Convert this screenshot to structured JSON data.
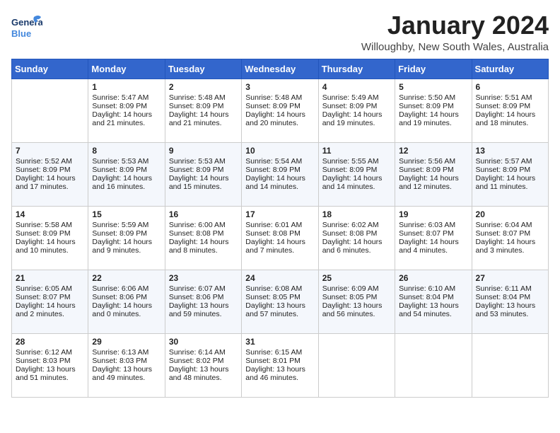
{
  "header": {
    "logo_text_general": "General",
    "logo_text_blue": "Blue",
    "month_title": "January 2024",
    "location": "Willoughby, New South Wales, Australia"
  },
  "weekdays": [
    "Sunday",
    "Monday",
    "Tuesday",
    "Wednesday",
    "Thursday",
    "Friday",
    "Saturday"
  ],
  "weeks": [
    [
      {
        "day": "",
        "empty": true
      },
      {
        "day": "1",
        "sunrise": "5:47 AM",
        "sunset": "8:09 PM",
        "daylight": "14 hours and 21 minutes."
      },
      {
        "day": "2",
        "sunrise": "5:48 AM",
        "sunset": "8:09 PM",
        "daylight": "14 hours and 21 minutes."
      },
      {
        "day": "3",
        "sunrise": "5:48 AM",
        "sunset": "8:09 PM",
        "daylight": "14 hours and 20 minutes."
      },
      {
        "day": "4",
        "sunrise": "5:49 AM",
        "sunset": "8:09 PM",
        "daylight": "14 hours and 19 minutes."
      },
      {
        "day": "5",
        "sunrise": "5:50 AM",
        "sunset": "8:09 PM",
        "daylight": "14 hours and 19 minutes."
      },
      {
        "day": "6",
        "sunrise": "5:51 AM",
        "sunset": "8:09 PM",
        "daylight": "14 hours and 18 minutes."
      }
    ],
    [
      {
        "day": "7",
        "sunrise": "5:52 AM",
        "sunset": "8:09 PM",
        "daylight": "14 hours and 17 minutes."
      },
      {
        "day": "8",
        "sunrise": "5:53 AM",
        "sunset": "8:09 PM",
        "daylight": "14 hours and 16 minutes."
      },
      {
        "day": "9",
        "sunrise": "5:53 AM",
        "sunset": "8:09 PM",
        "daylight": "14 hours and 15 minutes."
      },
      {
        "day": "10",
        "sunrise": "5:54 AM",
        "sunset": "8:09 PM",
        "daylight": "14 hours and 14 minutes."
      },
      {
        "day": "11",
        "sunrise": "5:55 AM",
        "sunset": "8:09 PM",
        "daylight": "14 hours and 14 minutes."
      },
      {
        "day": "12",
        "sunrise": "5:56 AM",
        "sunset": "8:09 PM",
        "daylight": "14 hours and 12 minutes."
      },
      {
        "day": "13",
        "sunrise": "5:57 AM",
        "sunset": "8:09 PM",
        "daylight": "14 hours and 11 minutes."
      }
    ],
    [
      {
        "day": "14",
        "sunrise": "5:58 AM",
        "sunset": "8:09 PM",
        "daylight": "14 hours and 10 minutes."
      },
      {
        "day": "15",
        "sunrise": "5:59 AM",
        "sunset": "8:09 PM",
        "daylight": "14 hours and 9 minutes."
      },
      {
        "day": "16",
        "sunrise": "6:00 AM",
        "sunset": "8:08 PM",
        "daylight": "14 hours and 8 minutes."
      },
      {
        "day": "17",
        "sunrise": "6:01 AM",
        "sunset": "8:08 PM",
        "daylight": "14 hours and 7 minutes."
      },
      {
        "day": "18",
        "sunrise": "6:02 AM",
        "sunset": "8:08 PM",
        "daylight": "14 hours and 6 minutes."
      },
      {
        "day": "19",
        "sunrise": "6:03 AM",
        "sunset": "8:07 PM",
        "daylight": "14 hours and 4 minutes."
      },
      {
        "day": "20",
        "sunrise": "6:04 AM",
        "sunset": "8:07 PM",
        "daylight": "14 hours and 3 minutes."
      }
    ],
    [
      {
        "day": "21",
        "sunrise": "6:05 AM",
        "sunset": "8:07 PM",
        "daylight": "14 hours and 2 minutes."
      },
      {
        "day": "22",
        "sunrise": "6:06 AM",
        "sunset": "8:06 PM",
        "daylight": "14 hours and 0 minutes."
      },
      {
        "day": "23",
        "sunrise": "6:07 AM",
        "sunset": "8:06 PM",
        "daylight": "13 hours and 59 minutes."
      },
      {
        "day": "24",
        "sunrise": "6:08 AM",
        "sunset": "8:05 PM",
        "daylight": "13 hours and 57 minutes."
      },
      {
        "day": "25",
        "sunrise": "6:09 AM",
        "sunset": "8:05 PM",
        "daylight": "13 hours and 56 minutes."
      },
      {
        "day": "26",
        "sunrise": "6:10 AM",
        "sunset": "8:04 PM",
        "daylight": "13 hours and 54 minutes."
      },
      {
        "day": "27",
        "sunrise": "6:11 AM",
        "sunset": "8:04 PM",
        "daylight": "13 hours and 53 minutes."
      }
    ],
    [
      {
        "day": "28",
        "sunrise": "6:12 AM",
        "sunset": "8:03 PM",
        "daylight": "13 hours and 51 minutes."
      },
      {
        "day": "29",
        "sunrise": "6:13 AM",
        "sunset": "8:03 PM",
        "daylight": "13 hours and 49 minutes."
      },
      {
        "day": "30",
        "sunrise": "6:14 AM",
        "sunset": "8:02 PM",
        "daylight": "13 hours and 48 minutes."
      },
      {
        "day": "31",
        "sunrise": "6:15 AM",
        "sunset": "8:01 PM",
        "daylight": "13 hours and 46 minutes."
      },
      {
        "day": "",
        "empty": true
      },
      {
        "day": "",
        "empty": true
      },
      {
        "day": "",
        "empty": true
      }
    ]
  ]
}
